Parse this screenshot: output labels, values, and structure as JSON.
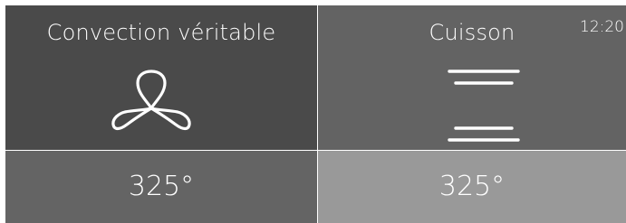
{
  "mode": {
    "label": "Convection véritable",
    "icon": "fan-icon"
  },
  "cook": {
    "label": "Cuisson",
    "icon": "heating-elements-icon"
  },
  "clock": "12:20",
  "temperatures": {
    "left": "325°",
    "right": "325°"
  },
  "colors": {
    "mode_panel": "#4a4a4a",
    "cook_panel": "#636363",
    "temp_left": "#646464",
    "temp_right": "#999999",
    "text": "#ffffff"
  }
}
